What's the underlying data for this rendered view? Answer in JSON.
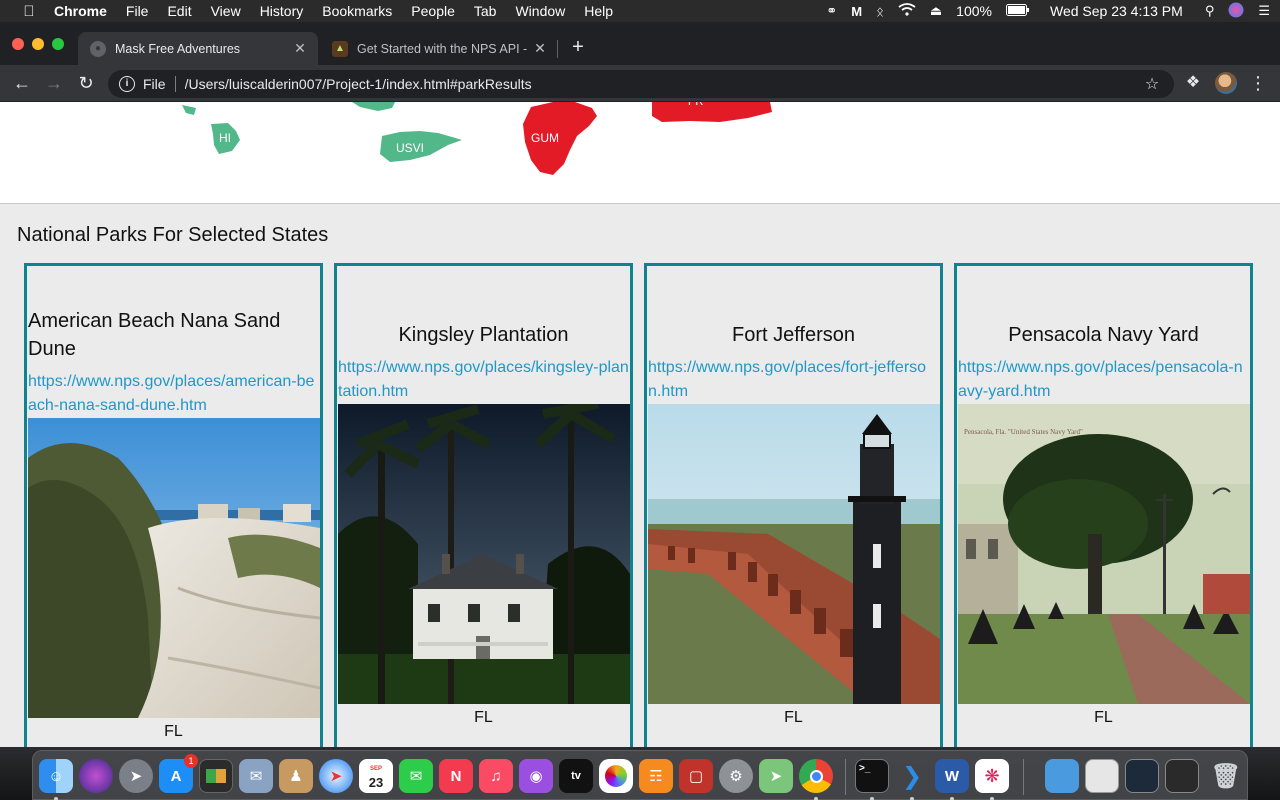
{
  "menubar": {
    "app": "Chrome",
    "items": [
      "File",
      "Edit",
      "View",
      "History",
      "Bookmarks",
      "People",
      "Tab",
      "Window",
      "Help"
    ],
    "battery": "100%",
    "datetime": "Wed Sep 23  4:13 PM",
    "status_icons": [
      "creative-cloud-icon",
      "malwarebytes-icon",
      "bluetooth-icon",
      "wifi-icon",
      "eject-icon",
      "battery-icon",
      "spotlight-icon",
      "siri-icon",
      "control-list-icon"
    ]
  },
  "browser": {
    "tabs": [
      {
        "title": "Mask Free Adventures",
        "active": true
      },
      {
        "title": "Get Started with the NPS API -",
        "active": false
      }
    ],
    "url_scheme": "File",
    "url": "/Users/luiscalderin007/Project-1/index.html#parkResults"
  },
  "map": {
    "labels": [
      "HI",
      "USVI",
      "GUM",
      "PR"
    ],
    "colors": {
      "visited": "#52b889",
      "selected": "#e21b27"
    }
  },
  "results": {
    "title": "National Parks For Selected States",
    "accent": "#0f8390",
    "link_color": "#1f98c8",
    "parks": [
      {
        "name": "American Beach Nana Sand Dune",
        "url": "https://www.nps.gov/places/american-beach-nana-sand-dune.htm",
        "state": "FL",
        "image": "sand-dune-photo"
      },
      {
        "name": "Kingsley Plantation",
        "url": "https://www.nps.gov/places/kingsley-plantation.htm",
        "state": "FL",
        "image": "plantation-house-night-photo"
      },
      {
        "name": "Fort Jefferson",
        "url": "https://www.nps.gov/places/fort-jefferson.htm",
        "state": "FL",
        "image": "fort-lighthouse-photo"
      },
      {
        "name": "Pensacola Navy Yard",
        "url": "https://www.nps.gov/places/pensacola-navy-yard.htm",
        "state": "FL",
        "image": "navy-yard-postcard-photo"
      }
    ],
    "postcard_caption": "Pensacola, Fla. \"United States Navy Yard\""
  },
  "dock": {
    "apps": [
      "Finder",
      "Siri",
      "Launchpad",
      "App Store",
      "Mission Control",
      "Mail",
      "Contacts",
      "Safari",
      "Calendar",
      "Messages",
      "News",
      "Music",
      "Podcasts",
      "TV",
      "Photos",
      "Books",
      "Photo Booth",
      "System Preferences",
      "Maps",
      "Chrome",
      "Terminal",
      "Visual Studio Code",
      "Word",
      "Slack",
      "Folder",
      "Preview",
      "Screenshot",
      "Window",
      "Trash"
    ],
    "calendar_month": "SEP",
    "calendar_day": "23",
    "app_store_badge": "1",
    "tv_label": "tv",
    "word_letter": "W"
  }
}
